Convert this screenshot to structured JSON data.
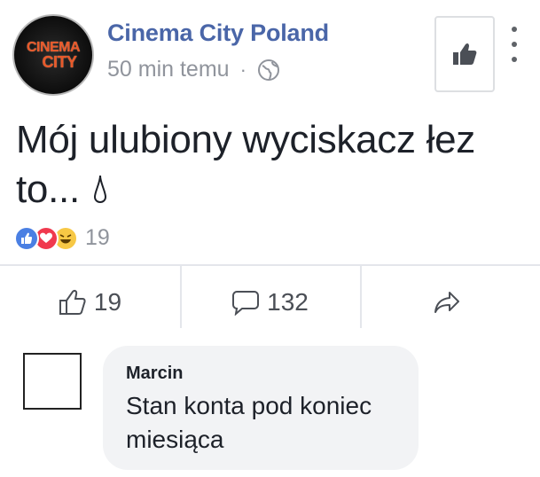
{
  "post": {
    "page_logo_line1": "CINEMA",
    "page_logo_line2": "CITY",
    "page_name": "Cinema City Poland",
    "time": "50 min temu",
    "separator": "·",
    "privacy_icon": "globe-icon",
    "header_like_icon": "thumbs-up-icon",
    "more_icon": "vertical-dots-icon",
    "text": "Mój ulubiony wyciskacz łez to...",
    "text_icon": "teardrop-icon"
  },
  "reactions": {
    "icons": [
      "like-reaction-icon",
      "love-reaction-icon",
      "haha-reaction-icon"
    ],
    "count": "19"
  },
  "actions": {
    "like_count": "19",
    "comment_count": "132",
    "share_icon": "share-arrow-icon"
  },
  "comment": {
    "author": "Marcin",
    "text": "Stan konta pod koniec miesiąca"
  },
  "colors": {
    "link_blue": "#4a66a8",
    "meta_gray": "#90949c",
    "bubble_bg": "#f2f3f5",
    "like_blue": "#4a7fe3",
    "love_red": "#f0394e",
    "haha_yellow": "#f7c845"
  }
}
